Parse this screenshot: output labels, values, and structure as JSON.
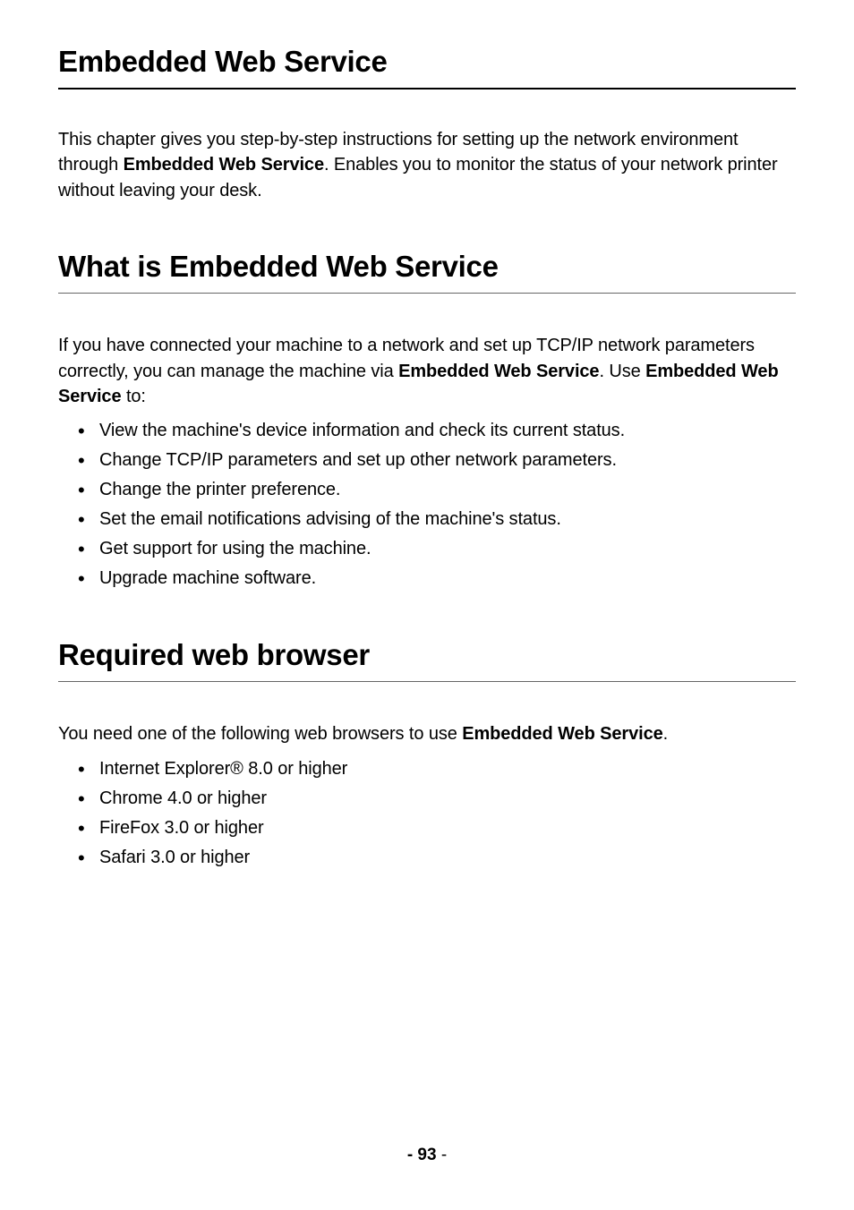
{
  "title": "Embedded Web Service",
  "intro": {
    "pre": "This chapter gives you step-by-step instructions for setting up the network environment through ",
    "bold": "Embedded Web Service",
    "post": ". Enables you to monitor the status of your network printer without leaving your desk."
  },
  "section1": {
    "heading": "What is Embedded Web Service",
    "para": {
      "t1": "If you have connected your machine to a network and set up TCP/IP network parameters correctly, you can manage the machine via ",
      "b1": "Embedded Web Service",
      "t2": ". Use ",
      "b2": "Embedded Web Service",
      "t3": " to:"
    },
    "items": [
      "View the machine's device information and check its current status.",
      "Change TCP/IP parameters and set up other network parameters.",
      "Change the printer preference.",
      "Set the email notifications advising of the machine's status.",
      "Get support for using the machine.",
      "Upgrade machine software."
    ]
  },
  "section2": {
    "heading": "Required web browser",
    "para": {
      "t1": "You need one of the following web browsers to use ",
      "b1": "Embedded Web Service",
      "t2": "."
    },
    "items": [
      "Internet Explorer® 8.0 or higher",
      "Chrome 4.0 or higher",
      "FireFox 3.0 or higher",
      "Safari 3.0 or higher"
    ]
  },
  "footer": {
    "dash": "- ",
    "num": "93",
    "trail": " -"
  }
}
